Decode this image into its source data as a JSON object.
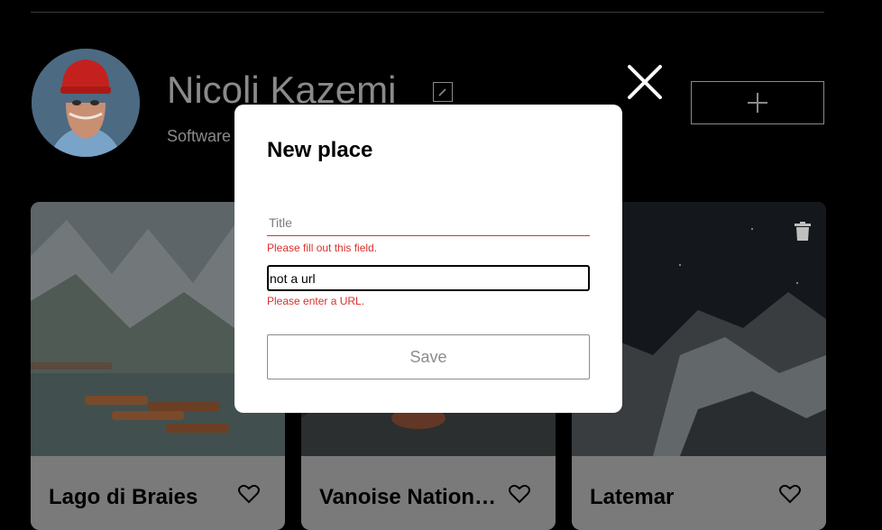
{
  "profile": {
    "name": "Nicoli Kazemi",
    "job": "Software"
  },
  "cards": [
    {
      "title": "Lago di Braies"
    },
    {
      "title": "Vanoise National Park"
    },
    {
      "title": "Latemar"
    }
  ],
  "modal": {
    "title": "New place",
    "title_placeholder": "Title",
    "title_error": "Please fill out this field.",
    "link_value": "not a url",
    "link_error": "Please enter a URL.",
    "save_label": "Save"
  },
  "icons": {
    "close": "close-icon",
    "add": "plus-icon",
    "edit": "pencil-icon",
    "like": "heart-icon",
    "delete": "trash-icon"
  },
  "colors": {
    "page_background": "#000000",
    "error": "#d9302d",
    "muted_text": "#8a8a8a",
    "modal_background": "#ffffff"
  }
}
